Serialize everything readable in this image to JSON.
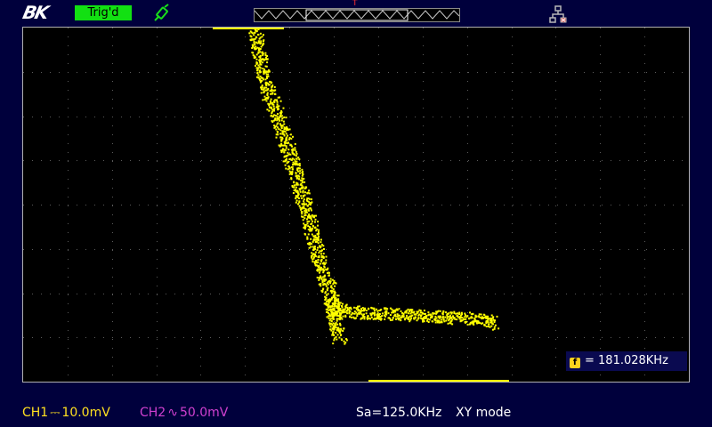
{
  "header": {
    "logo_text": "BK",
    "trigger_status": "Trig'd",
    "trigger_position_marker": "T",
    "icons": [
      "probe-icon",
      "network-icon"
    ]
  },
  "screen": {
    "grid": true,
    "trace_color": "#ffff00",
    "frequency_counter": {
      "icon_label": "f",
      "text": "= 181.028KHz"
    }
  },
  "status_bar": {
    "ch1": {
      "label": "CH1",
      "coupling_symbol": "⎓",
      "scale": "10.0mV"
    },
    "ch2": {
      "label": "CH2",
      "coupling_symbol": "∿",
      "scale": "50.0mV"
    },
    "sample_rate": "Sa=125.0KHz",
    "mode": "XY mode"
  },
  "colors": {
    "background": "#00003c",
    "screen": "#000000",
    "ch1": "#ffe020",
    "ch2": "#d040d0",
    "trigger_badge": "#12e012"
  }
}
